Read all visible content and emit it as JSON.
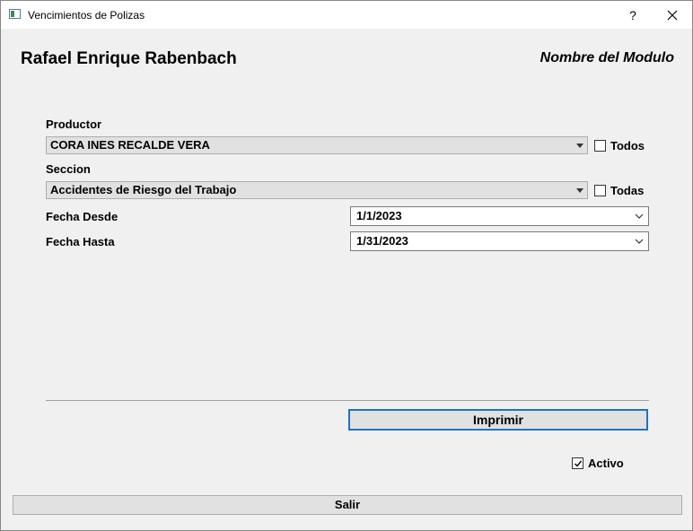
{
  "window": {
    "title": "Vencimientos de Polizas",
    "help_glyph": "?"
  },
  "header": {
    "user_name": "Rafael Enrique Rabenbach",
    "module_name": "Nombre del Modulo"
  },
  "form": {
    "productor": {
      "label": "Productor",
      "value": "CORA INES RECALDE VERA",
      "all_label": "Todos",
      "all_checked": false
    },
    "seccion": {
      "label": "Seccion",
      "value": "Accidentes de Riesgo del Trabajo",
      "all_label": "Todas",
      "all_checked": false
    },
    "fecha_desde": {
      "label": "Fecha Desde",
      "value": "1/1/2023"
    },
    "fecha_hasta": {
      "label": "Fecha Hasta",
      "value": "1/31/2023"
    }
  },
  "actions": {
    "print_label": "Imprimir",
    "active_label": "Activo",
    "active_checked": true,
    "quit_label": "Salir"
  },
  "colors": {
    "focus_border": "#1a73c8",
    "background": "#f0f0f0"
  }
}
